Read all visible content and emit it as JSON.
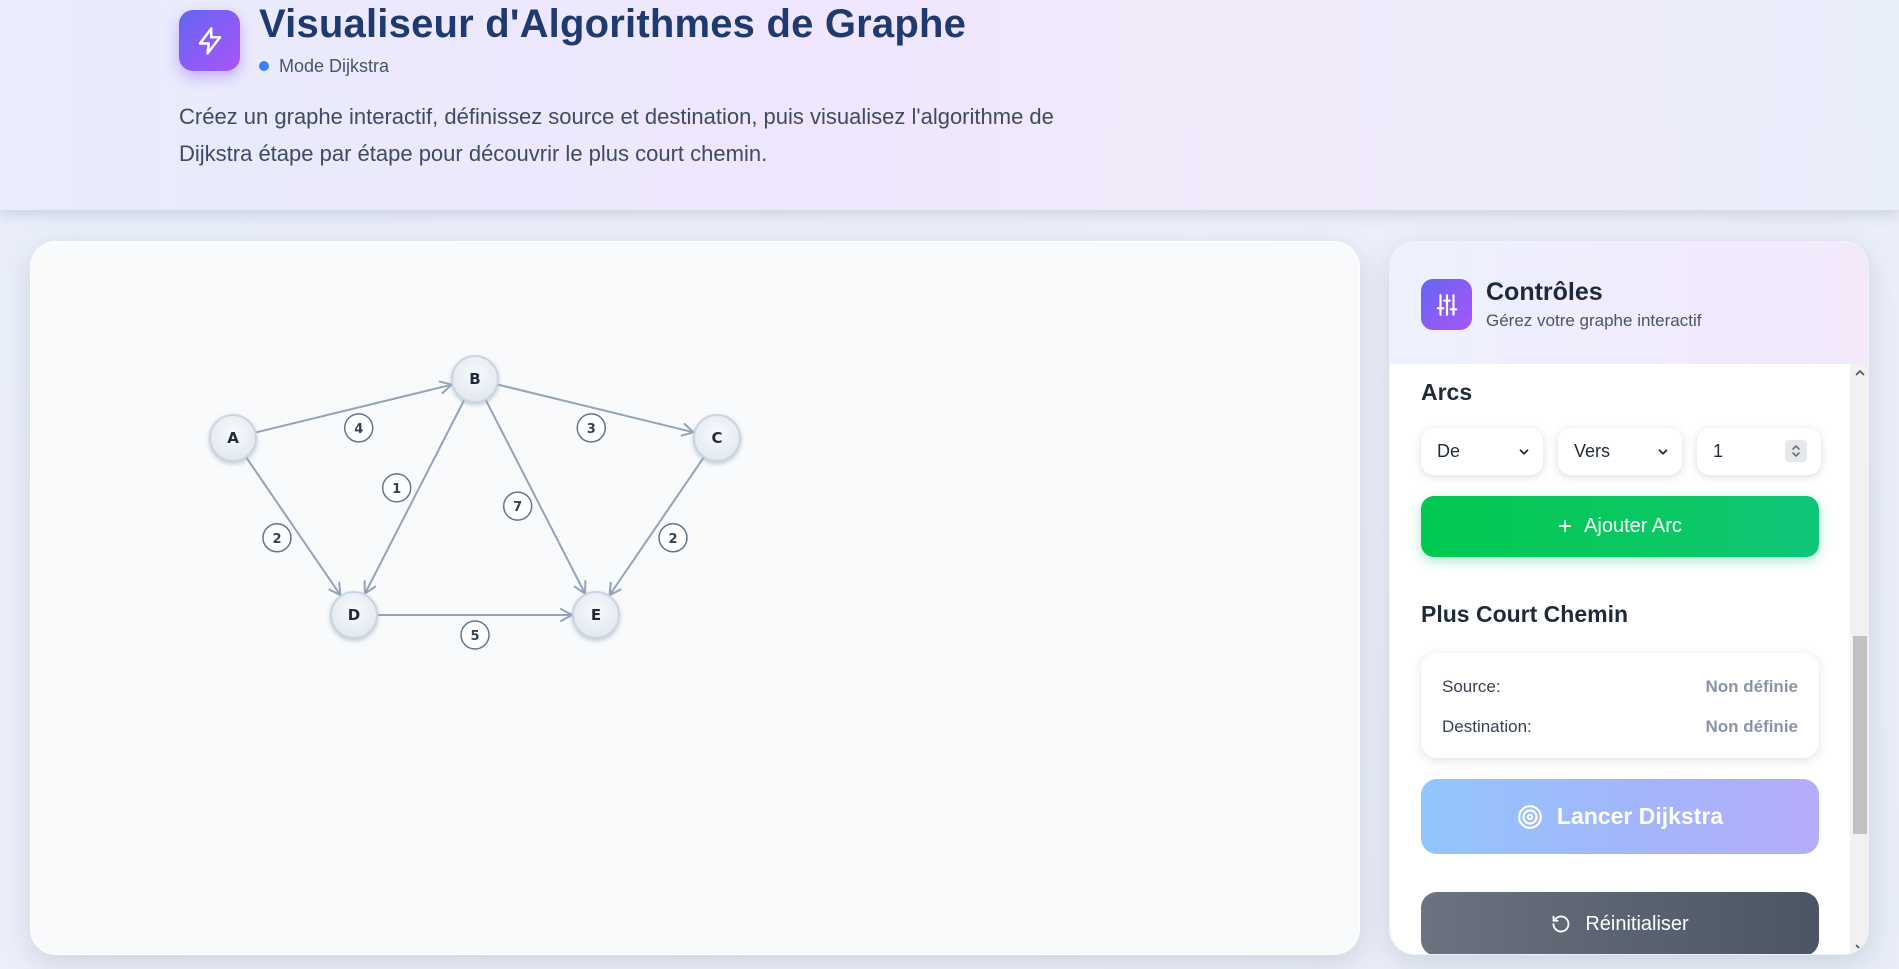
{
  "header": {
    "title": "Visualiseur d'Algorithmes de Graphe",
    "mode": "Mode Dijkstra",
    "description": "Créez un graphe interactif, définissez source et destination, puis visualisez l'algorithme de Dijkstra étape par étape pour découvrir le plus court chemin.",
    "logo_icon": "lightning-icon"
  },
  "graph": {
    "nodes": [
      {
        "id": "A",
        "label": "A"
      },
      {
        "id": "B",
        "label": "B"
      },
      {
        "id": "C",
        "label": "C"
      },
      {
        "id": "D",
        "label": "D"
      },
      {
        "id": "E",
        "label": "E"
      }
    ],
    "edges": [
      {
        "from": "A",
        "to": "B",
        "weight": "4"
      },
      {
        "from": "B",
        "to": "C",
        "weight": "3"
      },
      {
        "from": "A",
        "to": "D",
        "weight": "2"
      },
      {
        "from": "B",
        "to": "D",
        "weight": "1"
      },
      {
        "from": "B",
        "to": "E",
        "weight": "7"
      },
      {
        "from": "C",
        "to": "E",
        "weight": "2"
      },
      {
        "from": "D",
        "to": "E",
        "weight": "5"
      }
    ]
  },
  "controls": {
    "title": "Contrôles",
    "subtitle": "Gérez votre graphe interactif",
    "icon": "sliders-icon",
    "arcs": {
      "title": "Arcs",
      "from_placeholder": "De",
      "to_placeholder": "Vers",
      "weight_value": "1",
      "add_label": "Ajouter Arc"
    },
    "shortest_path": {
      "title": "Plus Court Chemin",
      "source_label": "Source:",
      "source_value": "Non définie",
      "destination_label": "Destination:",
      "destination_value": "Non définie",
      "run_label": "Lancer Dijkstra",
      "reset_label": "Réinitialiser"
    }
  },
  "colors": {
    "accent_gradient_start": "#6366f1",
    "accent_gradient_end": "#a855f7",
    "add_button": "#00c950",
    "run_button": "#a5b4fc",
    "reset_button": "#4b5563",
    "edge": "#94a3b8"
  }
}
